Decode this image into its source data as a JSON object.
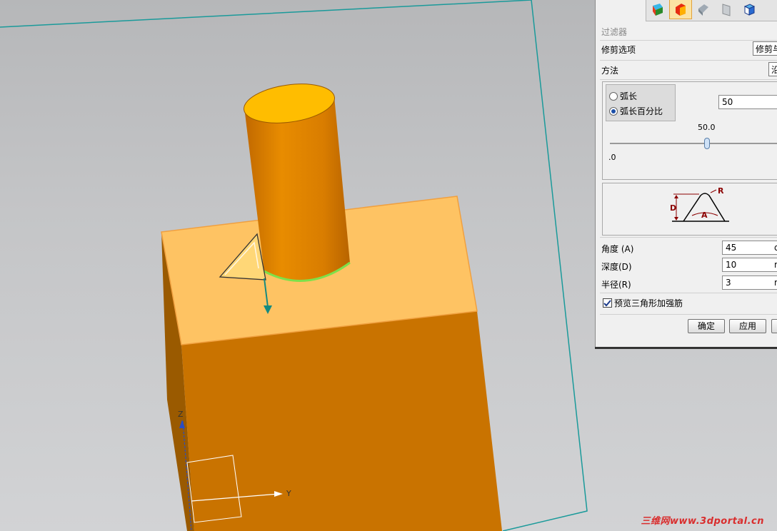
{
  "viewport": {
    "axis_z_label": "Z",
    "axis_y_label": "Y",
    "body_color": "#c97300",
    "top_face_color": "#fec363",
    "cylinder_color": "#e68a00",
    "plane_border_color": "#1a9a9a"
  },
  "dialog": {
    "toolbar_icons": [
      "solid-face-icon",
      "gusset-icon",
      "dim-face-icon",
      "sheet-icon",
      "view-cube-icon"
    ],
    "filter_label": "过滤器",
    "trim_options_label": "修剪选项",
    "trim_options_value": "修剪与",
    "method_label": "方法",
    "method_value": "沿",
    "radio_arc_length": "弧长",
    "radio_arc_percent": "弧长百分比",
    "position_value": "50",
    "slider_value_label": "50.0",
    "slider_min_label": ".0",
    "slider_value": 50,
    "diagram_label_r": "R",
    "diagram_label_d": "D",
    "diagram_label_a": "A",
    "angle_label": "角度 (A)",
    "angle_value": "45",
    "angle_unit": "d",
    "depth_label": "深度(D)",
    "depth_value": "10",
    "depth_unit": "m",
    "radius_label": "半径(R)",
    "radius_value": "3",
    "radius_unit": "m",
    "preview_label": "预览三角形加强筋",
    "preview_checked": true,
    "ok_button": "确定",
    "apply_button": "应用"
  },
  "watermark": "三维网www.3dportal.cn"
}
